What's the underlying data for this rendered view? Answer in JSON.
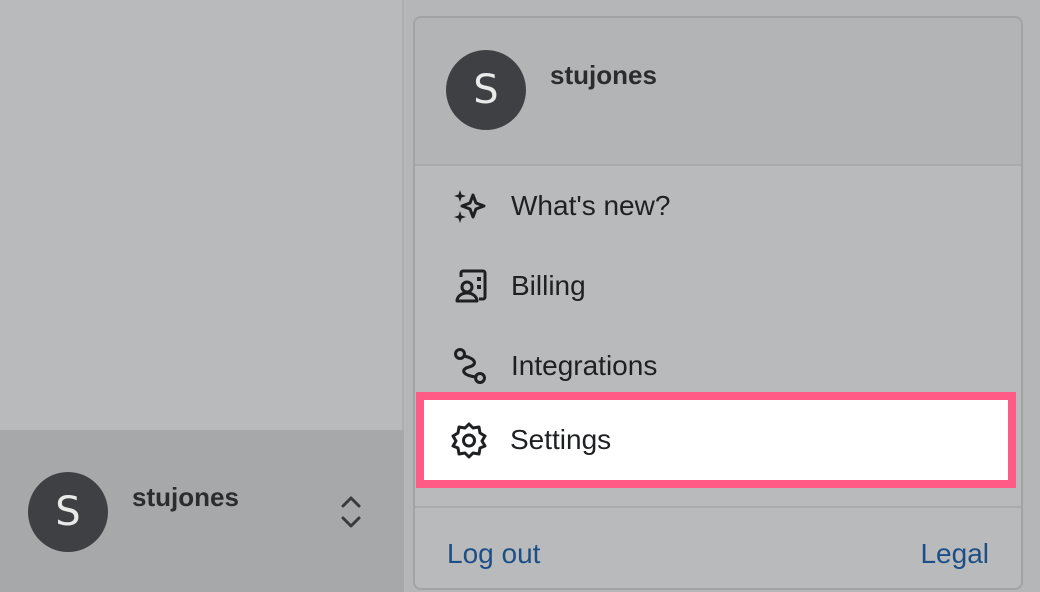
{
  "sidebar": {
    "user": {
      "avatar_initial": "S",
      "name": "stujones"
    }
  },
  "menu": {
    "header": {
      "avatar_initial": "S",
      "name": "stujones"
    },
    "items": [
      {
        "label": "What's new?",
        "icon": "sparkles-icon"
      },
      {
        "label": "Billing",
        "icon": "billing-icon"
      },
      {
        "label": "Integrations",
        "icon": "integrations-icon"
      },
      {
        "label": "Settings",
        "icon": "gear-icon",
        "highlighted": true
      }
    ],
    "footer": {
      "logout_label": "Log out",
      "legal_label": "Legal"
    }
  },
  "colors": {
    "highlight": "#ff5b86",
    "link": "#1d4f86",
    "avatar_bg": "#3f4043"
  }
}
